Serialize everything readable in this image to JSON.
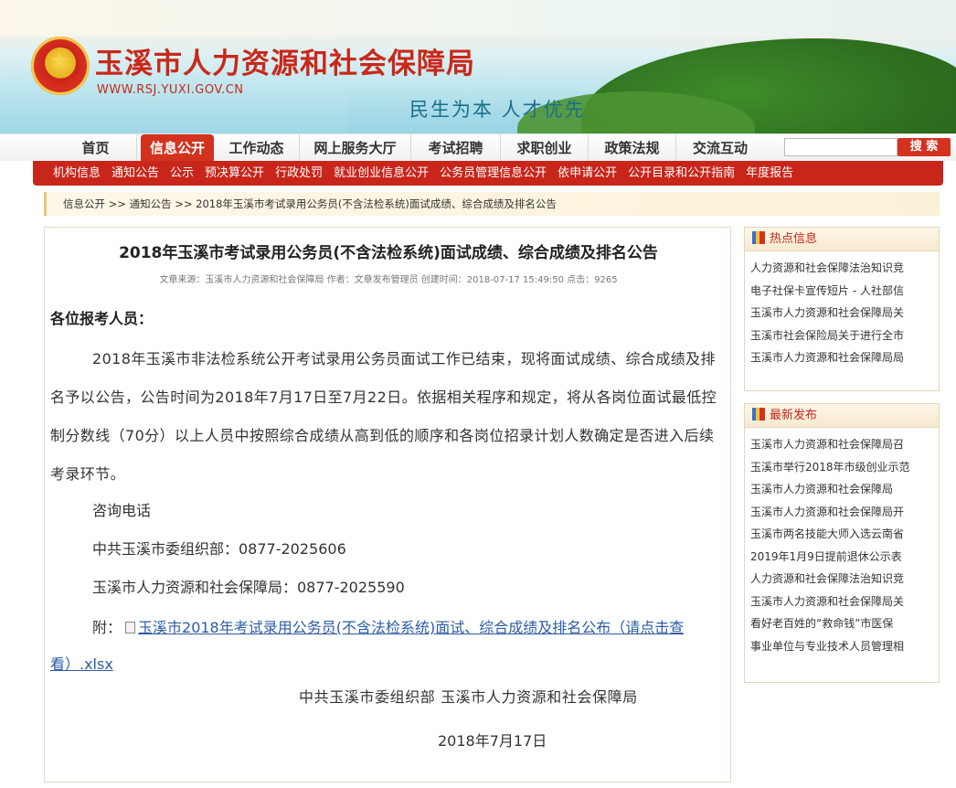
{
  "site": {
    "title": "玉溪市人力资源和社会保障局",
    "url": "WWW.RSJ.YUXI.GOV.CN",
    "slogan": "民生为本  人才优先"
  },
  "main_nav": {
    "items": [
      {
        "label": "首页",
        "active": false
      },
      {
        "label": "信息公开",
        "active": true
      },
      {
        "label": "工作动态",
        "active": false
      },
      {
        "label": "网上服务大厅",
        "active": false
      },
      {
        "label": "考试招聘",
        "active": false
      },
      {
        "label": "求职创业",
        "active": false
      },
      {
        "label": "政策法规",
        "active": false
      },
      {
        "label": "交流互动",
        "active": false
      }
    ],
    "search_value": "",
    "search_button": "搜 索"
  },
  "sub_nav": {
    "items": [
      "机构信息",
      "通知公告",
      "公示",
      "预决算公开",
      "行政处罚",
      "就业创业信息公开",
      "公务员管理信息公开",
      "依申请公开",
      "公开目录和公开指南",
      "年度报告"
    ]
  },
  "breadcrumb": "信息公开 >> 通知公告 >> 2018年玉溪市考试录用公务员(不含法检系统)面试成绩、综合成绩及排名公告",
  "article": {
    "title": "2018年玉溪市考试录用公务员(不含法检系统)面试成绩、综合成绩及排名公告",
    "meta": "文章来源：玉溪市人力资源和社会保障局 作者：文章发布管理员 创建时间：2018-07-17 15:49:50 点击：9265",
    "greeting": "各位报考人员：",
    "paragraph": "2018年玉溪市非法检系统公开考试录用公务员面试工作已结束，现将面试成绩、综合成绩及排名予以公告，公告时间为2018年7月17日至7月22日。依据相关程序和规定，将从各岗位面试最低控制分数线（70分）以上人员中按照综合成绩从高到低的顺序和各岗位招录计划人数确定是否进入后续考录环节。",
    "contact_heading": "咨询电话",
    "contact_1": "中共玉溪市委组织部：0877-2025606",
    "contact_2": "玉溪市人力资源和社会保障局：0877-2025590",
    "attachment_prefix": "附：",
    "attachment_link": "玉溪市2018年考试录用公务员(不含法检系统)面试、综合成绩及排名公布（请点击查看）.xlsx",
    "signature": "中共玉溪市委组织部    玉溪市人力资源和社会保障局",
    "date": "2018年7月17日"
  },
  "hot_info": {
    "title": "热点信息",
    "items": [
      "人力资源和社会保障法治知识竞",
      "电子社保卡宣传短片 - 人社部信",
      "玉溪市人力资源和社会保障局关",
      "玉溪市社会保险局关于进行全市",
      "玉溪市人力资源和社会保障局局"
    ]
  },
  "latest": {
    "title": "最新发布",
    "items": [
      "玉溪市人力资源和社会保障局召",
      "玉溪市举行2018年市级创业示范",
      "玉溪市人力资源和社会保障局",
      "玉溪市人力资源和社会保障局开",
      "玉溪市两名技能大师入选云南省",
      "2019年1月9日提前退休公示表",
      "人力资源和社会保障法治知识竞",
      "玉溪市人力资源和社会保障局关",
      "看好老百姓的“救命钱”市医保",
      "事业单位与专业技术人员管理相"
    ]
  }
}
